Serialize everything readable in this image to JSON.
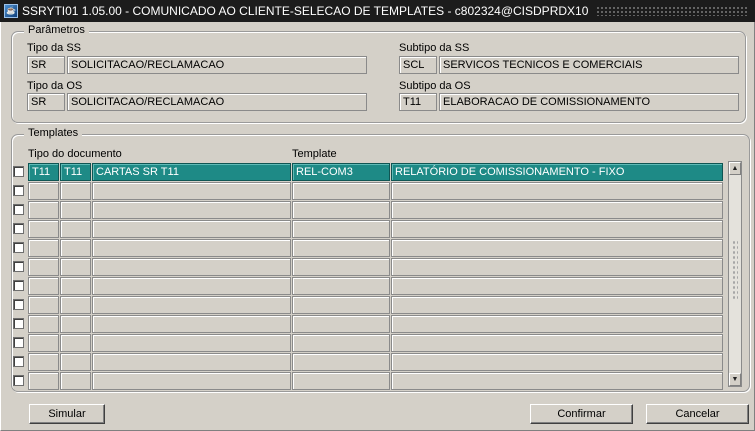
{
  "window": {
    "title": "SSRYTI01 1.05.00 - COMUNICADO AO CLIENTE-SELECAO DE TEMPLATES  - c802324@CISDPRDX10",
    "icon": "oracle-forms-app-icon"
  },
  "parametros": {
    "legend": "Parâmetros",
    "tipo_ss": {
      "label": "Tipo da SS",
      "code": "SR",
      "desc": "SOLICITACAO/RECLAMACAO"
    },
    "subtipo_ss": {
      "label": "Subtipo da SS",
      "code": "SCL",
      "desc": "SERVICOS TECNICOS E COMERCIAIS"
    },
    "tipo_os": {
      "label": "Tipo da OS",
      "code": "SR",
      "desc": "SOLICITACAO/RECLAMACAO"
    },
    "subtipo_os": {
      "label": "Subtipo da OS",
      "code": "T11",
      "desc": "ELABORACAO DE COMISSIONAMENTO"
    }
  },
  "templates": {
    "legend": "Templates",
    "header_tipo_documento": "Tipo do documento",
    "header_template": "Template",
    "rows": [
      {
        "c1": "T11",
        "c2": "T11",
        "c3": "CARTAS SR T11",
        "c4": "REL-COM3",
        "c5": "RELATÓRIO DE COMISSIONAMENTO - FIXO"
      },
      {
        "c1": "",
        "c2": "",
        "c3": "",
        "c4": "",
        "c5": ""
      },
      {
        "c1": "",
        "c2": "",
        "c3": "",
        "c4": "",
        "c5": ""
      },
      {
        "c1": "",
        "c2": "",
        "c3": "",
        "c4": "",
        "c5": ""
      },
      {
        "c1": "",
        "c2": "",
        "c3": "",
        "c4": "",
        "c5": ""
      },
      {
        "c1": "",
        "c2": "",
        "c3": "",
        "c4": "",
        "c5": ""
      },
      {
        "c1": "",
        "c2": "",
        "c3": "",
        "c4": "",
        "c5": ""
      },
      {
        "c1": "",
        "c2": "",
        "c3": "",
        "c4": "",
        "c5": ""
      },
      {
        "c1": "",
        "c2": "",
        "c3": "",
        "c4": "",
        "c5": ""
      },
      {
        "c1": "",
        "c2": "",
        "c3": "",
        "c4": "",
        "c5": ""
      },
      {
        "c1": "",
        "c2": "",
        "c3": "",
        "c4": "",
        "c5": ""
      },
      {
        "c1": "",
        "c2": "",
        "c3": "",
        "c4": "",
        "c5": ""
      }
    ],
    "selected_row": 0,
    "scroll_up_icon": "arrow-up-icon",
    "scroll_down_icon": "arrow-down-icon"
  },
  "buttons": {
    "simular": "Simular",
    "confirmar": "Confirmar",
    "cancelar": "Cancelar"
  },
  "colors": {
    "selected_row": "#1e8a86",
    "window_bg": "#d4d0c8",
    "titlebar_bg": "#1c1c1c"
  }
}
